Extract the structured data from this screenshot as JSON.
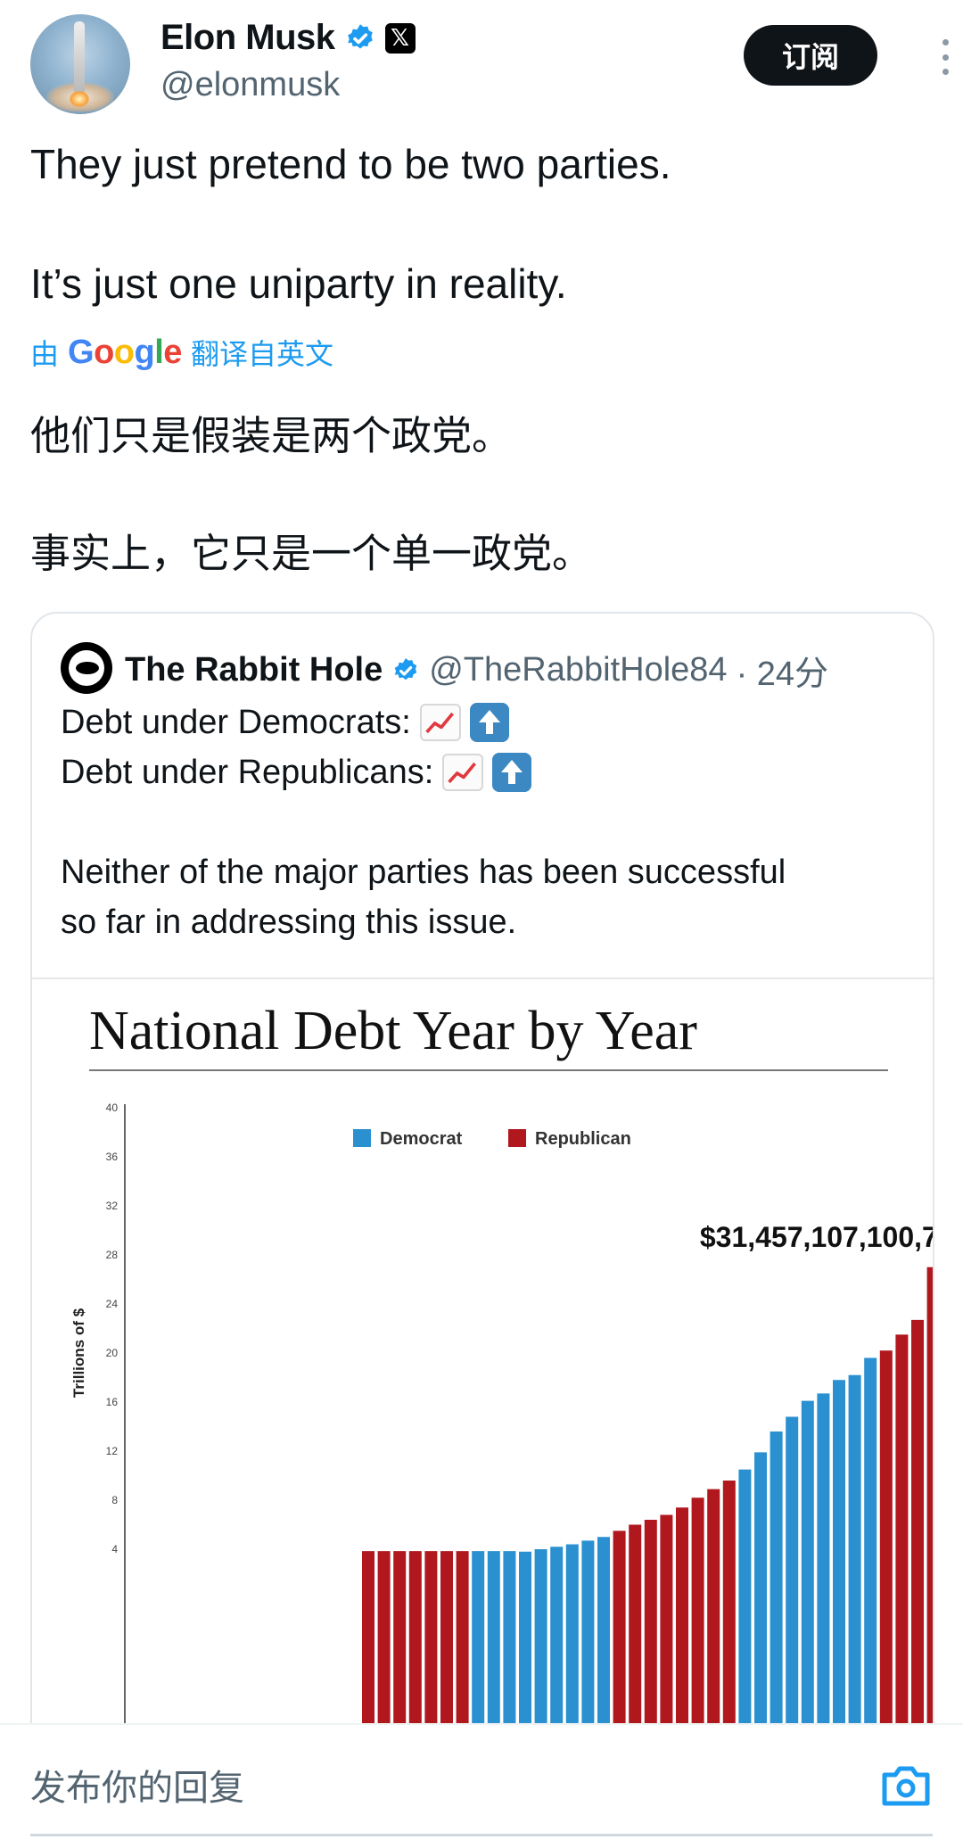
{
  "author": {
    "display_name": "Elon Musk",
    "handle": "@elonmusk",
    "x_badge": "𝕏",
    "avatar_icon": "rocket-launch-photo"
  },
  "subscribe_label": "订阅",
  "post": {
    "line1": "They just pretend to be two parties.",
    "line2": "It’s just one uniparty in reality."
  },
  "translation": {
    "prefix": "由",
    "google": [
      "G",
      "o",
      "o",
      "g",
      "l",
      "e"
    ],
    "suffix": "翻译自英文",
    "line1": "他们只是假装是两个政党。",
    "line2": "事实上，它只是一个单一政党。"
  },
  "quote": {
    "display_name": "The Rabbit Hole",
    "handle": "@TheRabbitHole84",
    "time": "· 24分",
    "line1": "Debt under Democrats:",
    "line2": "Debt under Republicans:",
    "line3": "Neither of the major parties has been successful",
    "line4": "so far in addressing this issue."
  },
  "chart_data": {
    "type": "bar",
    "title": "National Debt Year by Year",
    "ylabel": "Trillions of $",
    "ylim": [
      0,
      40
    ],
    "yticks": [
      4,
      8,
      12,
      16,
      20,
      24,
      28,
      32,
      36,
      40
    ],
    "legend": [
      {
        "name": "Democrat",
        "color": "#2a90d0"
      },
      {
        "name": "Republican",
        "color": "#b0181e"
      }
    ],
    "annotation": "$31,457,107,100,707",
    "values": [
      0.4,
      0.5,
      0.8,
      0.9,
      1.6,
      2.1,
      2.4,
      2.9,
      3.2,
      3.6,
      3.8,
      4.0,
      4.2,
      4.4,
      4.7,
      5.0,
      5.5,
      6.0,
      6.4,
      6.8,
      7.4,
      8.2,
      8.9,
      9.6,
      10.5,
      11.9,
      13.6,
      14.8,
      16.1,
      16.7,
      17.8,
      18.2,
      19.6,
      20.2,
      21.5,
      22.7,
      27.0,
      28.4,
      30.9,
      31.4
    ],
    "parties": [
      "R",
      "R",
      "R",
      "R",
      "R",
      "R",
      "R",
      "D",
      "D",
      "D",
      "D",
      "D",
      "D",
      "D",
      "D",
      "D",
      "R",
      "R",
      "R",
      "R",
      "R",
      "R",
      "R",
      "R",
      "D",
      "D",
      "D",
      "D",
      "D",
      "D",
      "D",
      "D",
      "D",
      "R",
      "R",
      "R",
      "R",
      "D",
      "D",
      "D"
    ],
    "visible_ymin": 3.7
  },
  "reply": {
    "placeholder": "发布你的回复",
    "camera_icon": "camera-icon"
  }
}
